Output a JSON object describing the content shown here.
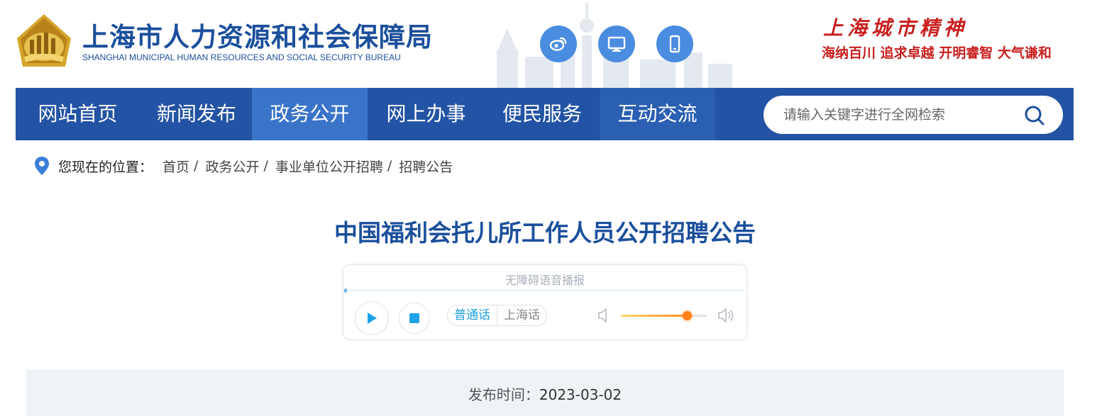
{
  "header": {
    "site_name": "上海市人力资源和社会保障局",
    "site_name_en": "SHANGHAI MUNICIPAL HUMAN RESOURCES AND SOCIAL SECURITY BUREAU",
    "spirit_title": "上海城市精神",
    "spirit_tags": "海纳百川  追求卓越  开明睿智  大气谦和",
    "social_icons": [
      "weibo-icon",
      "desktop-icon",
      "mobile-icon"
    ]
  },
  "nav": {
    "items": [
      {
        "label": "网站首页",
        "active": false
      },
      {
        "label": "新闻发布",
        "active": false
      },
      {
        "label": "政务公开",
        "active": true
      },
      {
        "label": "网上办事",
        "active": false
      },
      {
        "label": "便民服务",
        "active": false
      },
      {
        "label": "互动交流",
        "active": false
      }
    ],
    "search_placeholder": "请输入关键字进行全网检索"
  },
  "breadcrumb": {
    "label": "您现在的位置：",
    "items": [
      "首页",
      "政务公开",
      "事业单位公开招聘",
      "招聘公告"
    ],
    "separator": "/"
  },
  "article": {
    "title": "中国福利会托儿所工作人员公开招聘公告",
    "publish_label": "发布时间：",
    "publish_date": "2023-03-02"
  },
  "player": {
    "title": "无障碍语音播报",
    "languages": [
      {
        "label": "普通话",
        "active": true
      },
      {
        "label": "上海话",
        "active": false
      }
    ],
    "volume": 0.76
  },
  "colors": {
    "brand_blue": "#1b4f9c",
    "nav_bg": "#2353a4",
    "nav_active": "#3a74c8",
    "spirit_red": "#c91f1f",
    "player_accent": "#1e9fe0",
    "volume_accent": "#ff7f17"
  }
}
